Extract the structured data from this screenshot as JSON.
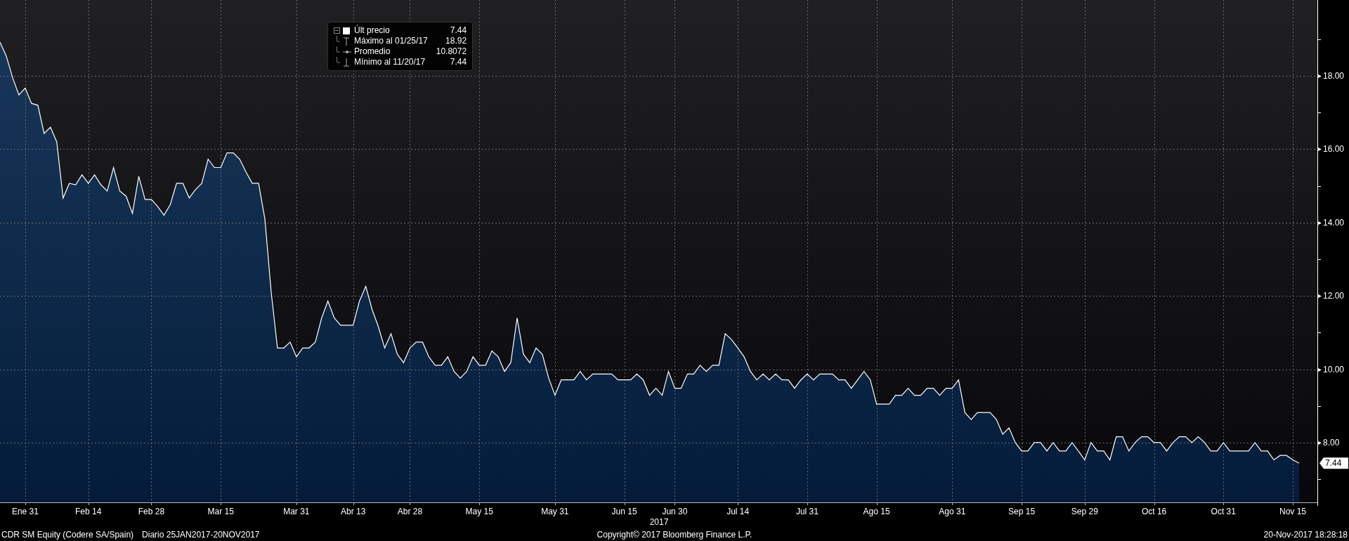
{
  "chart_panel": {
    "legend": [
      {
        "kind": "last",
        "value": "7.44"
      },
      {
        "kind": "max",
        "label": "Máximo al 01/25/17",
        "value": "18.92"
      },
      {
        "kind": "avg",
        "label": "Promedio",
        "value": "10.8072"
      },
      {
        "kind": "min",
        "label": "Mínimo al 11/20/17",
        "value": "7.44"
      }
    ],
    "last_value_tag": "7.44",
    "year_label": "2017",
    "chart_data": {
      "type": "area",
      "grid": true,
      "ylim": [
        6.37,
        20.07
      ],
      "yticks": [
        {
          "value": 8,
          "label": "8.00"
        },
        {
          "value": 10,
          "label": "10.00"
        },
        {
          "value": 12,
          "label": "12.00"
        },
        {
          "value": 14,
          "label": "14.00"
        },
        {
          "value": 16,
          "label": "16.00"
        },
        {
          "value": 18,
          "label": "18.00"
        }
      ],
      "categories": [
        null,
        null,
        null,
        null,
        "Ene 31",
        null,
        null,
        null,
        null,
        null,
        null,
        null,
        null,
        null,
        "Feb 14",
        null,
        null,
        null,
        null,
        null,
        null,
        null,
        null,
        null,
        "Feb 28",
        null,
        null,
        null,
        null,
        null,
        null,
        null,
        null,
        null,
        null,
        "Mar 15",
        null,
        null,
        null,
        null,
        null,
        null,
        null,
        null,
        null,
        null,
        null,
        "Mar 31",
        null,
        null,
        null,
        null,
        null,
        null,
        null,
        null,
        "Abr 13",
        null,
        null,
        null,
        null,
        null,
        null,
        null,
        null,
        "Abr 28",
        null,
        null,
        null,
        null,
        null,
        null,
        null,
        null,
        null,
        null,
        "May 15",
        null,
        null,
        null,
        null,
        null,
        null,
        null,
        null,
        null,
        null,
        null,
        "May 31",
        null,
        null,
        null,
        null,
        null,
        null,
        null,
        null,
        null,
        null,
        "Jun 15",
        null,
        null,
        null,
        null,
        null,
        null,
        null,
        "Jun 30",
        null,
        null,
        null,
        null,
        null,
        null,
        null,
        null,
        null,
        "Jul 14",
        null,
        null,
        null,
        null,
        null,
        null,
        null,
        null,
        null,
        null,
        "Jul 31",
        null,
        null,
        null,
        null,
        null,
        null,
        null,
        null,
        null,
        null,
        "Ago 15",
        null,
        null,
        null,
        null,
        null,
        null,
        null,
        null,
        null,
        null,
        null,
        "Ago 31",
        null,
        null,
        null,
        null,
        null,
        null,
        null,
        null,
        null,
        null,
        "Sep 15",
        null,
        null,
        null,
        null,
        null,
        null,
        null,
        null,
        null,
        "Sep 29",
        null,
        null,
        null,
        null,
        null,
        null,
        null,
        null,
        null,
        null,
        "Oct 16",
        null,
        null,
        null,
        null,
        null,
        null,
        null,
        null,
        null,
        null,
        "Oct 31",
        null,
        null,
        null,
        null,
        null,
        null,
        null,
        null,
        null,
        null,
        "Nov 15",
        null
      ],
      "series": [
        {
          "name": "Últ precio",
          "color": "#ffffff",
          "values": [
            18.92,
            18.54,
            17.95,
            17.48,
            17.67,
            17.25,
            17.2,
            16.43,
            16.6,
            16.2,
            14.67,
            15.07,
            15.03,
            15.3,
            15.07,
            15.3,
            15.03,
            14.86,
            15.5,
            14.86,
            14.72,
            14.25,
            15.26,
            14.63,
            14.63,
            14.44,
            14.2,
            14.49,
            15.07,
            15.07,
            14.67,
            14.9,
            15.07,
            15.73,
            15.5,
            15.5,
            15.9,
            15.9,
            15.73,
            15.38,
            15.07,
            15.07,
            14.1,
            12.1,
            10.58,
            10.58,
            10.74,
            10.34,
            10.58,
            10.58,
            10.74,
            11.4,
            11.86,
            11.4,
            11.2,
            11.2,
            11.2,
            11.86,
            12.26,
            11.63,
            11.16,
            10.58,
            10.97,
            10.41,
            10.18,
            10.58,
            10.74,
            10.74,
            10.34,
            10.11,
            10.11,
            10.34,
            9.94,
            9.76,
            9.94,
            10.34,
            10.11,
            10.11,
            10.5,
            10.34,
            9.94,
            10.18,
            11.4,
            10.41,
            10.18,
            10.58,
            10.41,
            9.76,
            9.29,
            9.71,
            9.71,
            9.71,
            9.94,
            9.71,
            9.87,
            9.87,
            9.87,
            9.87,
            9.71,
            9.71,
            9.71,
            9.87,
            9.71,
            9.29,
            9.48,
            9.29,
            9.94,
            9.48,
            9.48,
            9.87,
            9.87,
            10.11,
            9.94,
            10.11,
            10.11,
            10.97,
            10.81,
            10.58,
            10.34,
            9.94,
            9.71,
            9.87,
            9.71,
            9.87,
            9.71,
            9.71,
            9.48,
            9.71,
            9.87,
            9.71,
            9.87,
            9.87,
            9.87,
            9.71,
            9.71,
            9.48,
            9.71,
            9.94,
            9.71,
            9.05,
            9.05,
            9.05,
            9.29,
            9.29,
            9.48,
            9.29,
            9.29,
            9.48,
            9.48,
            9.29,
            9.48,
            9.48,
            9.71,
            8.82,
            8.63,
            8.82,
            8.82,
            8.82,
            8.63,
            8.23,
            8.4,
            8.0,
            7.77,
            7.77,
            8.0,
            8.0,
            7.77,
            8.0,
            7.77,
            7.77,
            8.0,
            7.77,
            7.53,
            8.0,
            7.77,
            7.77,
            7.53,
            8.16,
            8.16,
            7.77,
            8.0,
            8.16,
            8.16,
            8.0,
            8.0,
            7.77,
            8.0,
            8.16,
            8.16,
            8.0,
            8.16,
            8.0,
            7.77,
            7.77,
            8.0,
            7.77,
            7.77,
            7.77,
            7.77,
            8.0,
            7.77,
            7.77,
            7.53,
            7.65,
            7.65,
            7.53,
            7.44
          ]
        }
      ]
    }
  },
  "footer": {
    "security": "CDR SM Equity (Codere SA/Spain)",
    "period": "Diario 25JAN2017-20NOV2017",
    "copyright": "Copyright© 2017 Bloomberg Finance L.P.",
    "timestamp": "20-Nov-2017 18:28:18"
  }
}
